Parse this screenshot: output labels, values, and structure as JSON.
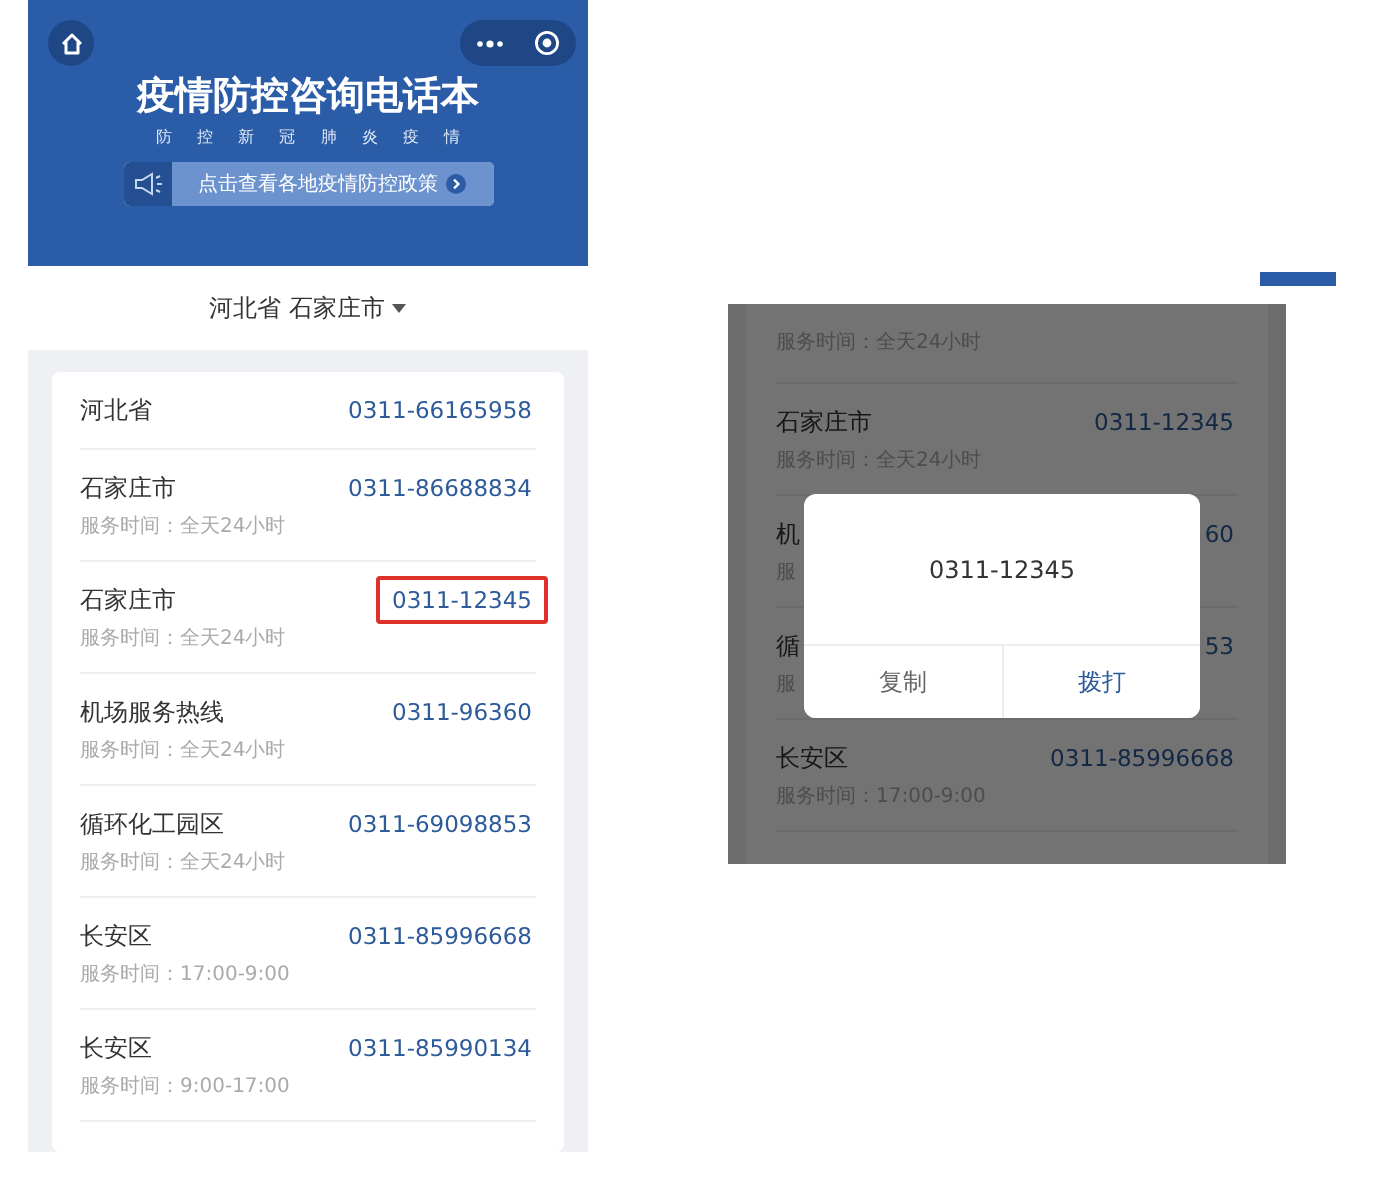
{
  "left_screen": {
    "header": {
      "title": "疫情防控咨询电话本",
      "subtitle": "防 控 新 冠 肺 炎 疫 情",
      "banner": "点击查看各地疫情防控政策"
    },
    "location": "河北省 石家庄市",
    "rows": [
      {
        "name": "河北省",
        "phone": "0311-66165958",
        "highlighted": false
      },
      {
        "name": "石家庄市",
        "phone": "0311-86688834",
        "hours": "服务时间：全天24小时",
        "highlighted": false
      },
      {
        "name": "石家庄市",
        "phone": "0311-12345",
        "hours": "服务时间：全天24小时",
        "highlighted": true
      },
      {
        "name": "机场服务热线",
        "phone": "0311-96360",
        "hours": "服务时间：全天24小时",
        "highlighted": false
      },
      {
        "name": "循环化工园区",
        "phone": "0311-69098853",
        "hours": "服务时间：全天24小时",
        "highlighted": false
      },
      {
        "name": "长安区",
        "phone": "0311-85996668",
        "hours": "服务时间：17:00-9:00",
        "highlighted": false
      },
      {
        "name": "长安区",
        "phone": "0311-85990134",
        "hours": "服务时间：9:00-17:00",
        "highlighted": false
      }
    ]
  },
  "right_screen": {
    "rows": [
      {
        "hours": "服务时间：全天24小时"
      },
      {
        "name": "石家庄市",
        "phone": "0311-12345",
        "hours": "服务时间：全天24小时"
      },
      {
        "name": "机",
        "phone": "60",
        "hours": "服"
      },
      {
        "name": "循",
        "phone": "53",
        "hours": "服"
      },
      {
        "name": "长安区",
        "phone": "0311-85996668",
        "hours": "服务时间：17:00-9:00"
      }
    ],
    "dialog": {
      "number": "0311-12345",
      "buttons": [
        {
          "label": "复制",
          "kind": "secondary"
        },
        {
          "label": "拨打",
          "kind": "primary"
        }
      ]
    }
  }
}
